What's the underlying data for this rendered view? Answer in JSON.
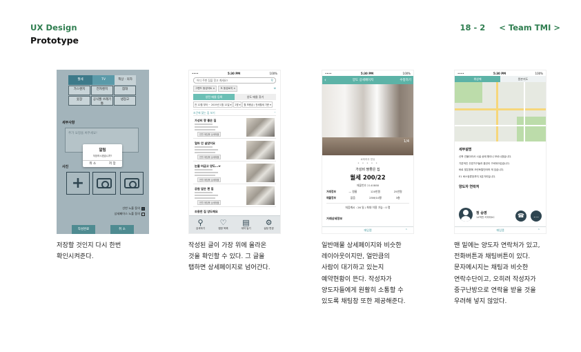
{
  "header": {
    "section": "UX Design",
    "title": "Prototype",
    "page": "18 - 2",
    "team": "< Team TMI >"
  },
  "screen1": {
    "tabs": [
      "월세",
      "TV",
      "책상 · 의자"
    ],
    "options": [
      "가스렌지",
      "전자렌지",
      "침대",
      "옷장",
      "공식월 쓰레기통",
      "냉장고"
    ],
    "memo_label": "세부사항",
    "memo_placeholder": "추가 요청을 써주세요!",
    "dialog": {
      "title": "알림",
      "message": "저장하시겠습니까?",
      "cancel": "취 소",
      "save": "저 장"
    },
    "photo_label": "사진",
    "check1": "선반 노출 동의",
    "check2": "상세페이스 노출 동의",
    "btn_left": "작성완료",
    "btn_right": "취 소"
  },
  "screen2": {
    "time": "5:30 PM",
    "battery": "100%",
    "search_placeholder": "어디 주변 집을 찾고 계세요?",
    "chip1": "그랜드 동성아트 ×",
    "chip2": "도 동성로지 ×",
    "tab_on": "양전 매물 등록",
    "tab_off": "양도 매물 찾기",
    "filters": [
      "전 12월 부터 ~ 2019년 1월 12일 ▾",
      "2명 ▾",
      "월 보증금 / 전세월세 기준 ▾"
    ],
    "sort_label": "조건에 맞는 집 보기",
    "listings": [
      {
        "title": "가성비 짱 좋은 집",
        "badge": "전월 매칭률 상세매물"
      },
      {
        "title": "얼마 안 살았어요",
        "badge": "전월 매칭률 상세매물"
      },
      {
        "title": "눈물 머금고 양도…ㅠ",
        "badge": "전월 매칭률 상세매물"
      },
      {
        "title": "공원 앞은 편 집",
        "badge": "전월 매칭률 상세매물"
      },
      {
        "title": "조용한 집 양도해요"
      }
    ],
    "tabbar": [
      {
        "icon": "⚲",
        "label": "검색하기"
      },
      {
        "icon": "♡",
        "label": "찜한 목록"
      },
      {
        "icon": "▤",
        "label": "계약 일기"
      },
      {
        "icon": "⚙",
        "label": "설정 변경"
      }
    ]
  },
  "screen3": {
    "time": "5:30 PM",
    "battery": "100%",
    "nav_back": "‹",
    "nav_title": "양도 상세페이지",
    "nav_action": "수정하기",
    "photo_count": "1/4",
    "tag": "로띠하우 방유",
    "dots": "• • • • •",
    "subtitle": "가성비 짱좋은 집",
    "price": "월세 200/22",
    "listing_id": "매물번호 2140888",
    "row1": {
      "key": "거래정보",
      "values": [
        "— 원룸",
        "120만원",
        "25만원"
      ]
    },
    "row2": {
      "key": "매물정보",
      "values": [
        "없음",
        "25M/10평",
        "3층"
      ]
    },
    "date": "처음계시 : 26 일 / 최대 이용 가능 : 0 명",
    "section": "거래상세정보",
    "bottom": "매입맵"
  },
  "screen4": {
    "time": "5:30 PM",
    "battery": "100%",
    "tab_on": "위성에",
    "tab_off": "원본지도",
    "detail_title": "세부설명",
    "details": [
      "신축 건물이라서 시설 상태 짱이니 모르시겠습니다.",
      "기본적인 주방가구들과 옵션이 구비되어있습니다.",
      "바로 맞은편에 크린토탈빈라하 게 있습니다.",
      "E1 버스정류장까지 3분거리입니다."
    ],
    "contact_title": "양도자 연락처",
    "agent_name": "정 승영",
    "agent_company": "14학번 커미터KC",
    "call_icon": "☎",
    "chat_icon": "…",
    "bottom": "매입맵"
  },
  "captions": {
    "c1": [
      "저장할 것인지 다시 한번",
      "확인시켜준다."
    ],
    "c2": [
      "작성된 글이 가장 위에 올라온",
      "것을 확인할 수 있다. 그 글을",
      "탭하면 상세페이지로 넘어간다."
    ],
    "c3": [
      "일반매물 상세페이지와 비슷한",
      "레이아웃이지만, 얼만큼의",
      "사람이 대기하고 있는지",
      "예약현황이 뜬다. 작성자가",
      "양도자들에게 원활히 소통할 수",
      "있도록 채팅창 또한 제공해준다."
    ],
    "c4": [
      "맨 밑에는 양도자 연락처가 있고,",
      "전화버튼과 채팅버튼이 있다.",
      "문자메시지는 채팅과 비슷한",
      "연락수단이고, 오히려 작성자가",
      "중구난방으로 연락을 받을 것을",
      "우려해 넣지 않았다."
    ]
  }
}
